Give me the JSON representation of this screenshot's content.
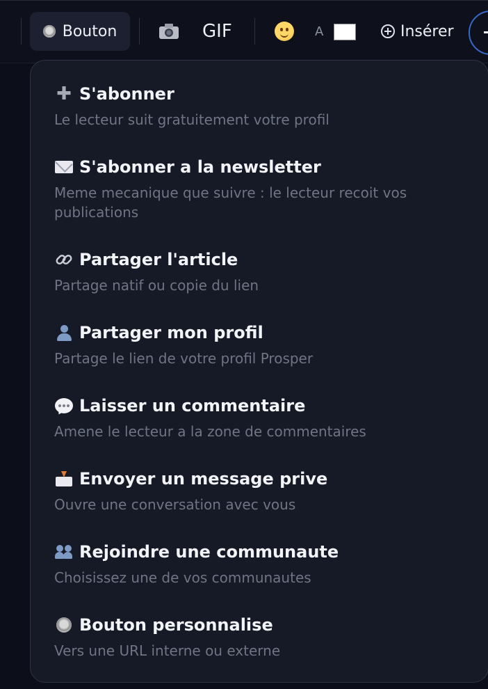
{
  "toolbar": {
    "button_label": "Bouton",
    "gif_label": "GIF",
    "font_letter": "A",
    "insert_label": "Insérer",
    "icons": [
      "radio-button-icon",
      "camera-icon",
      "emoji-icon",
      "font-color-icon",
      "plus-circle-icon"
    ]
  },
  "menu": {
    "items": [
      {
        "icon": "plus-icon",
        "title": "S'abonner",
        "description": "Le lecteur suit gratuitement votre profil"
      },
      {
        "icon": "envelope-icon",
        "title": "S'abonner a la newsletter",
        "description": "Meme mecanique que suivre : le lecteur recoit vos publications"
      },
      {
        "icon": "link-icon",
        "title": "Partager l'article",
        "description": "Partage natif ou copie du lien"
      },
      {
        "icon": "user-icon",
        "title": "Partager mon profil",
        "description": "Partage le lien de votre profil Prosper"
      },
      {
        "icon": "speech-bubble-icon",
        "title": "Laisser un commentaire",
        "description": "Amene le lecteur a la zone de commentaires"
      },
      {
        "icon": "inbox-tray-icon",
        "title": "Envoyer un message prive",
        "description": "Ouvre une conversation avec vous"
      },
      {
        "icon": "users-icon",
        "title": "Rejoindre une communaute",
        "description": "Choisissez une de vos communautes"
      },
      {
        "icon": "radio-button-icon",
        "title": "Bouton personnalise",
        "description": "Vers une URL interne ou externe"
      }
    ]
  },
  "colors": {
    "background": "#0c0f1a",
    "menu_background": "#161926",
    "title_text": "#f3f4f8",
    "description_text": "#6f7585",
    "accent_ring": "#3a66c8"
  }
}
